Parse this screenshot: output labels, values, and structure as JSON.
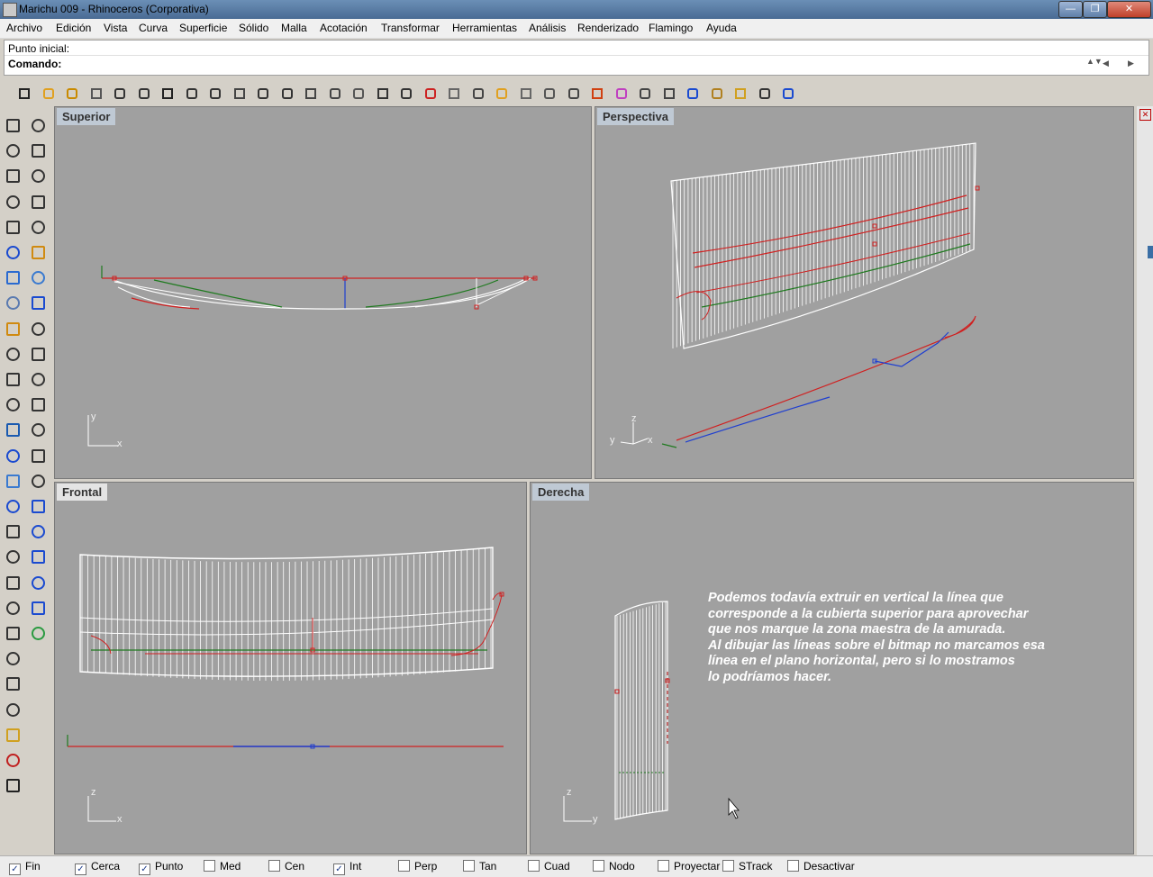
{
  "window": {
    "title": "Marichu 009 - Rhinoceros (Corporativa)",
    "minimize": "—",
    "maximize": "❐",
    "close": "✕"
  },
  "menu": [
    "Archivo",
    "Edición",
    "Vista",
    "Curva",
    "Superficie",
    "Sólido",
    "Malla",
    "Acotación",
    "Transformar",
    "Herramientas",
    "Análisis",
    "Renderizado",
    "Flamingo",
    "Ayuda"
  ],
  "command": {
    "prompt": "Punto inicial:",
    "label": "Comando:",
    "value": ""
  },
  "viewports": {
    "top": {
      "title": "Superior",
      "axis_x": "x",
      "axis_y": "y"
    },
    "perspective": {
      "title": "Perspectiva",
      "axis_x": "x",
      "axis_y": "y",
      "axis_z": "z"
    },
    "front": {
      "title": "Frontal",
      "axis_x": "x",
      "axis_z": "z"
    },
    "right": {
      "title": "Derecha",
      "axis_y": "y",
      "axis_z": "z",
      "note": "Podemos todavía extruir en vertical la línea que\ncorresponde a la cubierta superior para aprovechar\nque nos marque la zona maestra de la amurada.\nAl dibujar las líneas sobre el bitmap no marcamos esa\nlínea en el plano horizontal, pero si lo mostramos\nlo podríamos hacer."
    }
  },
  "osnaps": [
    {
      "label": "Fin",
      "checked": true
    },
    {
      "label": "Cerca",
      "checked": true
    },
    {
      "label": "Punto",
      "checked": true
    },
    {
      "label": "Med",
      "checked": false
    },
    {
      "label": "Cen",
      "checked": false
    },
    {
      "label": "Int",
      "checked": true
    },
    {
      "label": "Perp",
      "checked": false
    },
    {
      "label": "Tan",
      "checked": false
    },
    {
      "label": "Cuad",
      "checked": false
    },
    {
      "label": "Nodo",
      "checked": false
    },
    {
      "label": "Proyectar",
      "checked": false
    },
    {
      "label": "STrack",
      "checked": false
    },
    {
      "label": "Desactivar",
      "checked": false
    }
  ],
  "colors": {
    "viewport_bg": "#a0a0a0",
    "curve_red": "#d02020",
    "curve_green": "#1f7a1f",
    "curve_blue": "#1f3fd0",
    "wire": "#ffffff"
  },
  "toolbar_icons": [
    "new-icon",
    "open-icon",
    "save-icon",
    "print-icon",
    "import-icon",
    "cut-icon",
    "copy-icon",
    "paste-icon",
    "undo-icon",
    "pan-icon",
    "rotate-view-icon",
    "zoom-icon",
    "zoom-window-icon",
    "zoom-extents-icon",
    "zoom-selected-icon",
    "snap-icon",
    "grid-icon",
    "car-icon",
    "render-icon",
    "point-icon",
    "scale-icon",
    "toggle-icon",
    "lock-icon",
    "cplane-icon",
    "layer-icon",
    "color-icon",
    "material-icon",
    "shade-icon",
    "light-icon",
    "wand-icon",
    "sun-icon",
    "tool-icon",
    "help-icon"
  ],
  "left_icons_a": [
    "select-icon",
    "polyline-icon",
    "circle-icon",
    "arc-icon",
    "polygon-icon",
    "surface-icon",
    "box-icon",
    "cylinder-icon",
    "gear-icon",
    "trim-icon",
    "boolean-icon",
    "fillet-icon",
    "text-icon",
    "array-icon",
    "mesh-icon",
    "dimension-icon",
    "xyz-icon",
    "measure-icon",
    "distance-icon",
    "angle-icon",
    "curve-analysis-icon",
    "question-icon",
    "section-icon",
    "label-icon",
    "rainbow-icon",
    "object-icon",
    "check-icon"
  ],
  "left_icons_b": [
    "point-icon",
    "curve-icon",
    "ellipse-icon",
    "rectangle-icon",
    "fillet-curve-icon",
    "extrude-icon",
    "sphere-icon",
    "plane-icon",
    "explode-icon",
    "split-icon",
    "group-icon",
    "blend-icon",
    "offset-icon",
    "project-icon",
    "join-icon",
    "grid-view-icon",
    "frame-icon",
    "flat-view-icon",
    "gumball-icon",
    "move-icon",
    "picture-icon"
  ]
}
